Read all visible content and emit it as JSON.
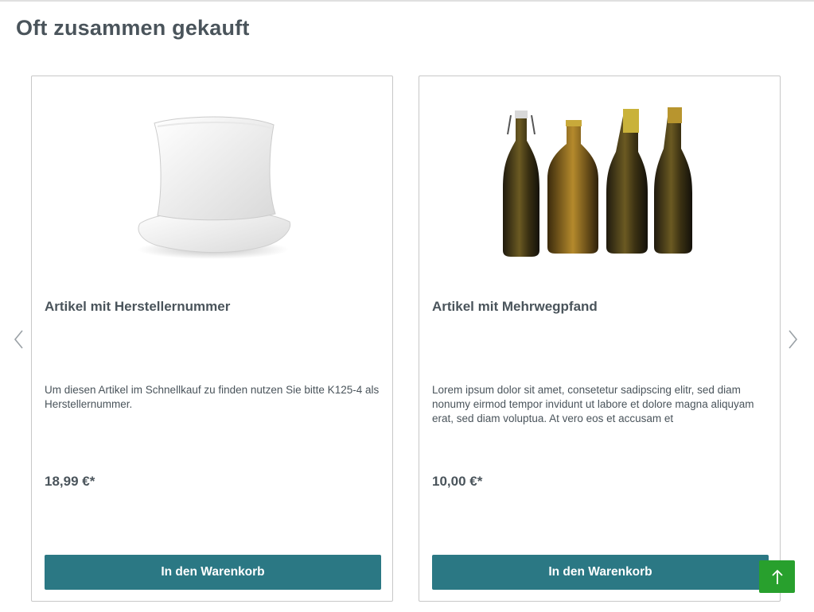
{
  "section": {
    "title": "Oft zusammen gekauft"
  },
  "products": [
    {
      "image_icon": "pillow-image",
      "name": "Artikel mit Herstellernummer",
      "description": "Um diesen Artikel im Schnellkauf zu finden nutzen Sie bitte  K125-4 als Herstellernummer.",
      "price": "18,99 €*",
      "button_label": "In den Warenkorb"
    },
    {
      "image_icon": "bottles-image",
      "name": "Artikel mit Mehrwegpfand",
      "description": "Lorem ipsum dolor sit amet, consetetur sadipscing elitr, sed diam nonumy eirmod tempor invidunt ut labore et dolore magna aliquyam erat, sed diam voluptua. At vero eos et accusam et",
      "price": "10,00 €*",
      "button_label": "In den Warenkorb"
    }
  ],
  "slider": {
    "prev_icon": "chevron-left-icon",
    "next_icon": "chevron-right-icon"
  },
  "scroll_top": {
    "icon": "arrow-up-icon"
  },
  "colors": {
    "button": "#2b7884",
    "scroll_top": "#28a02d",
    "text": "#4a545b",
    "card_border": "#c7c7c7"
  }
}
